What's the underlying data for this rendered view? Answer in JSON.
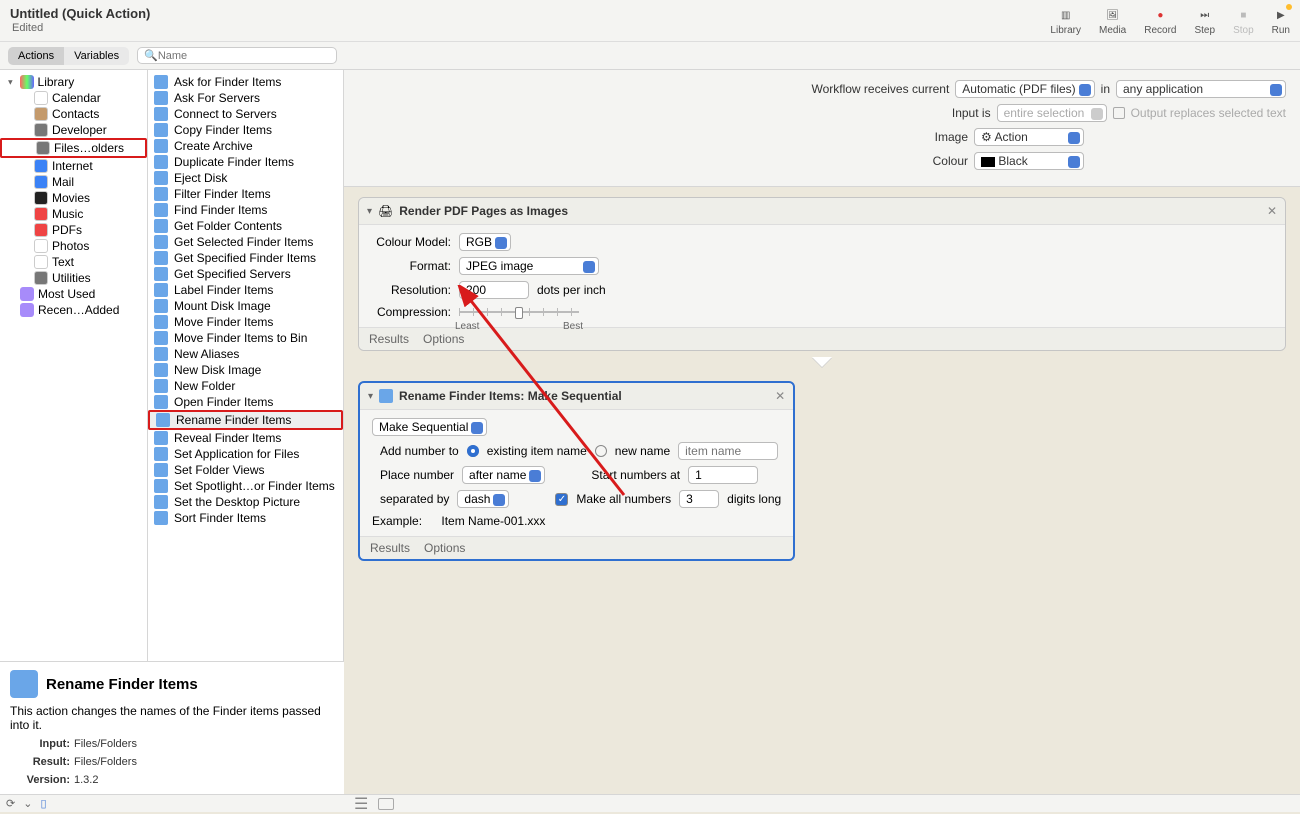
{
  "window": {
    "title": "Untitled (Quick Action)",
    "subtitle": "Edited"
  },
  "toolbar": {
    "library": "Library",
    "media": "Media",
    "record": "Record",
    "step": "Step",
    "stop": "Stop",
    "run": "Run"
  },
  "tabs": {
    "actions": "Actions",
    "variables": "Variables"
  },
  "search": {
    "placeholder": "Name"
  },
  "library": {
    "root": "Library",
    "items": [
      "Calendar",
      "Contacts",
      "Developer",
      "Files…olders",
      "Internet",
      "Mail",
      "Movies",
      "Music",
      "PDFs",
      "Photos",
      "Text",
      "Utilities"
    ],
    "extra": [
      "Most Used",
      "Recen…Added"
    ]
  },
  "actions_list": [
    "Ask for Finder Items",
    "Ask For Servers",
    "Connect to Servers",
    "Copy Finder Items",
    "Create Archive",
    "Duplicate Finder Items",
    "Eject Disk",
    "Filter Finder Items",
    "Find Finder Items",
    "Get Folder Contents",
    "Get Selected Finder Items",
    "Get Specified Finder Items",
    "Get Specified Servers",
    "Label Finder Items",
    "Mount Disk Image",
    "Move Finder Items",
    "Move Finder Items to Bin",
    "New Aliases",
    "New Disk Image",
    "New Folder",
    "Open Finder Items",
    "Rename Finder Items",
    "Reveal Finder Items",
    "Set Application for Files",
    "Set Folder Views",
    "Set Spotlight…or Finder Items",
    "Set the Desktop Picture",
    "Sort Finder Items"
  ],
  "workflow_header": {
    "receives_label": "Workflow receives current",
    "receives_value": "Automatic (PDF files)",
    "in_label": "in",
    "in_value": "any application",
    "input_is_label": "Input is",
    "input_is_value": "entire selection",
    "output_replaces": "Output replaces selected text",
    "image_label": "Image",
    "image_value": "Action",
    "colour_label": "Colour",
    "colour_value": "Black"
  },
  "action1": {
    "title": "Render PDF Pages as Images",
    "colour_model_label": "Colour Model:",
    "colour_model_value": "RGB",
    "format_label": "Format:",
    "format_value": "JPEG image",
    "resolution_label": "Resolution:",
    "resolution_value": "200",
    "resolution_unit": "dots per inch",
    "compression_label": "Compression:",
    "least": "Least",
    "best": "Best",
    "results": "Results",
    "options": "Options"
  },
  "action2": {
    "title": "Rename Finder Items: Make Sequential",
    "mode": "Make Sequential",
    "add_number_label": "Add number to",
    "existing": "existing item name",
    "newname": "new name",
    "newname_placeholder": "item name",
    "place_label": "Place number",
    "place_value": "after name",
    "start_label": "Start numbers at",
    "start_value": "1",
    "sep_label": "separated by",
    "sep_value": "dash",
    "make_all_label": "Make all numbers",
    "digits_value": "3",
    "digits_unit": "digits long",
    "example_label": "Example:",
    "example_value": "Item Name-001.xxx",
    "results": "Results",
    "options": "Options"
  },
  "info": {
    "title": "Rename Finder Items",
    "desc": "This action changes the names of the Finder items passed into it.",
    "input_label": "Input:",
    "input_value": "Files/Folders",
    "result_label": "Result:",
    "result_value": "Files/Folders",
    "version_label": "Version:",
    "version_value": "1.3.2"
  }
}
